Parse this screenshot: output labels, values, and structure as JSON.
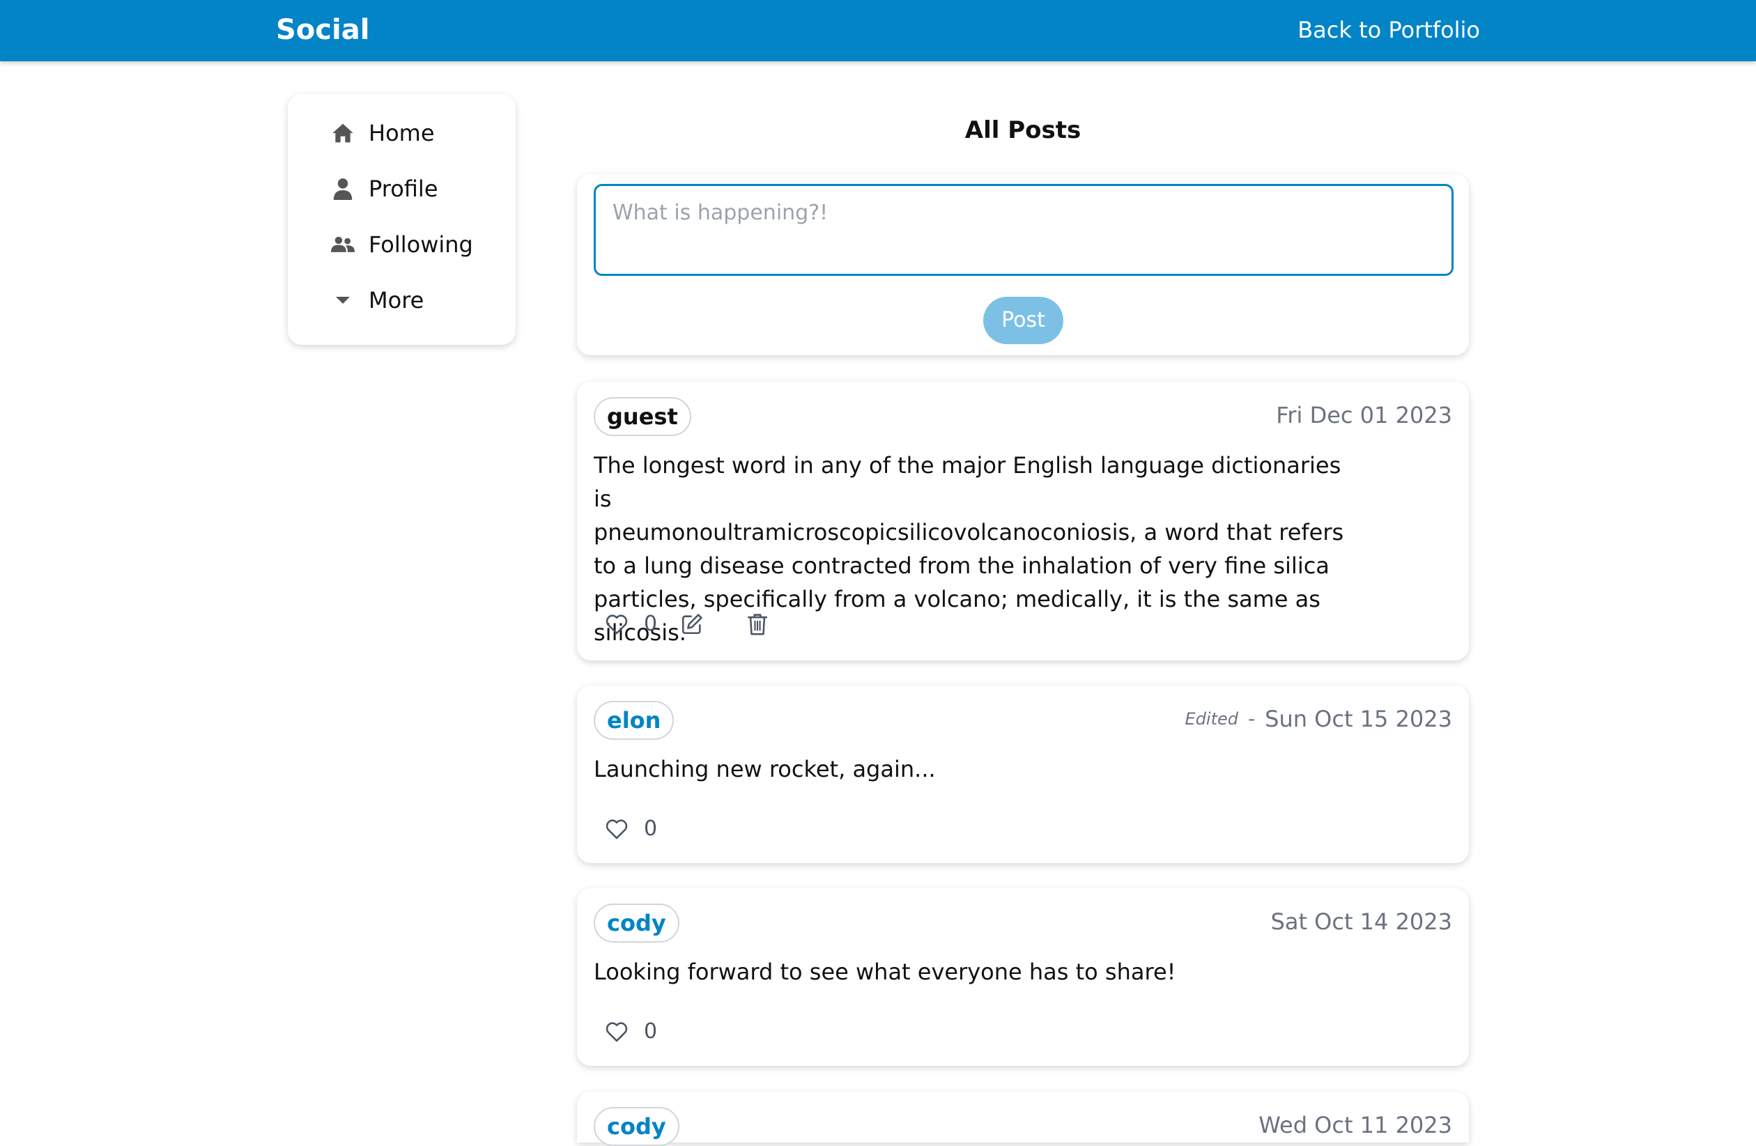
{
  "header": {
    "brand": "Social",
    "back_link": "Back to Portfolio"
  },
  "sidebar": {
    "items": [
      {
        "label": "Home",
        "icon": "home-icon"
      },
      {
        "label": "Profile",
        "icon": "user-icon"
      },
      {
        "label": "Following",
        "icon": "users-icon"
      },
      {
        "label": "More",
        "icon": "caret-down-icon"
      }
    ]
  },
  "main": {
    "title": "All Posts"
  },
  "composer": {
    "placeholder": "What is happening?!",
    "value": "",
    "post_label": "Post"
  },
  "posts": [
    {
      "author": "guest",
      "date": "Fri Dec 01 2023",
      "body": "The longest word in any of the major English language dictionaries is\npneumonoultramicroscopicsilicovolcanoconiosis, a word that refers\nto a lung disease contracted from the inhalation of very fine silica\nparticles, specifically from a volcano; medically, it is the same as silicosis.",
      "likes": "0",
      "own": true
    },
    {
      "author": "elon",
      "edited": "Edited",
      "separator": "-",
      "date": "Sun Oct 15 2023",
      "body": "Launching new rocket, again...",
      "likes": "0",
      "own": false
    },
    {
      "author": "cody",
      "date": "Sat Oct 14 2023",
      "body": "Looking forward to see what everyone has to share!",
      "likes": "0",
      "own": false
    },
    {
      "author": "cody",
      "date": "Wed Oct 11 2023",
      "own": false
    }
  ],
  "colors": {
    "brand": "#0284c7",
    "post_button": "#7dc0e5",
    "muted_text": "#6b7280"
  }
}
